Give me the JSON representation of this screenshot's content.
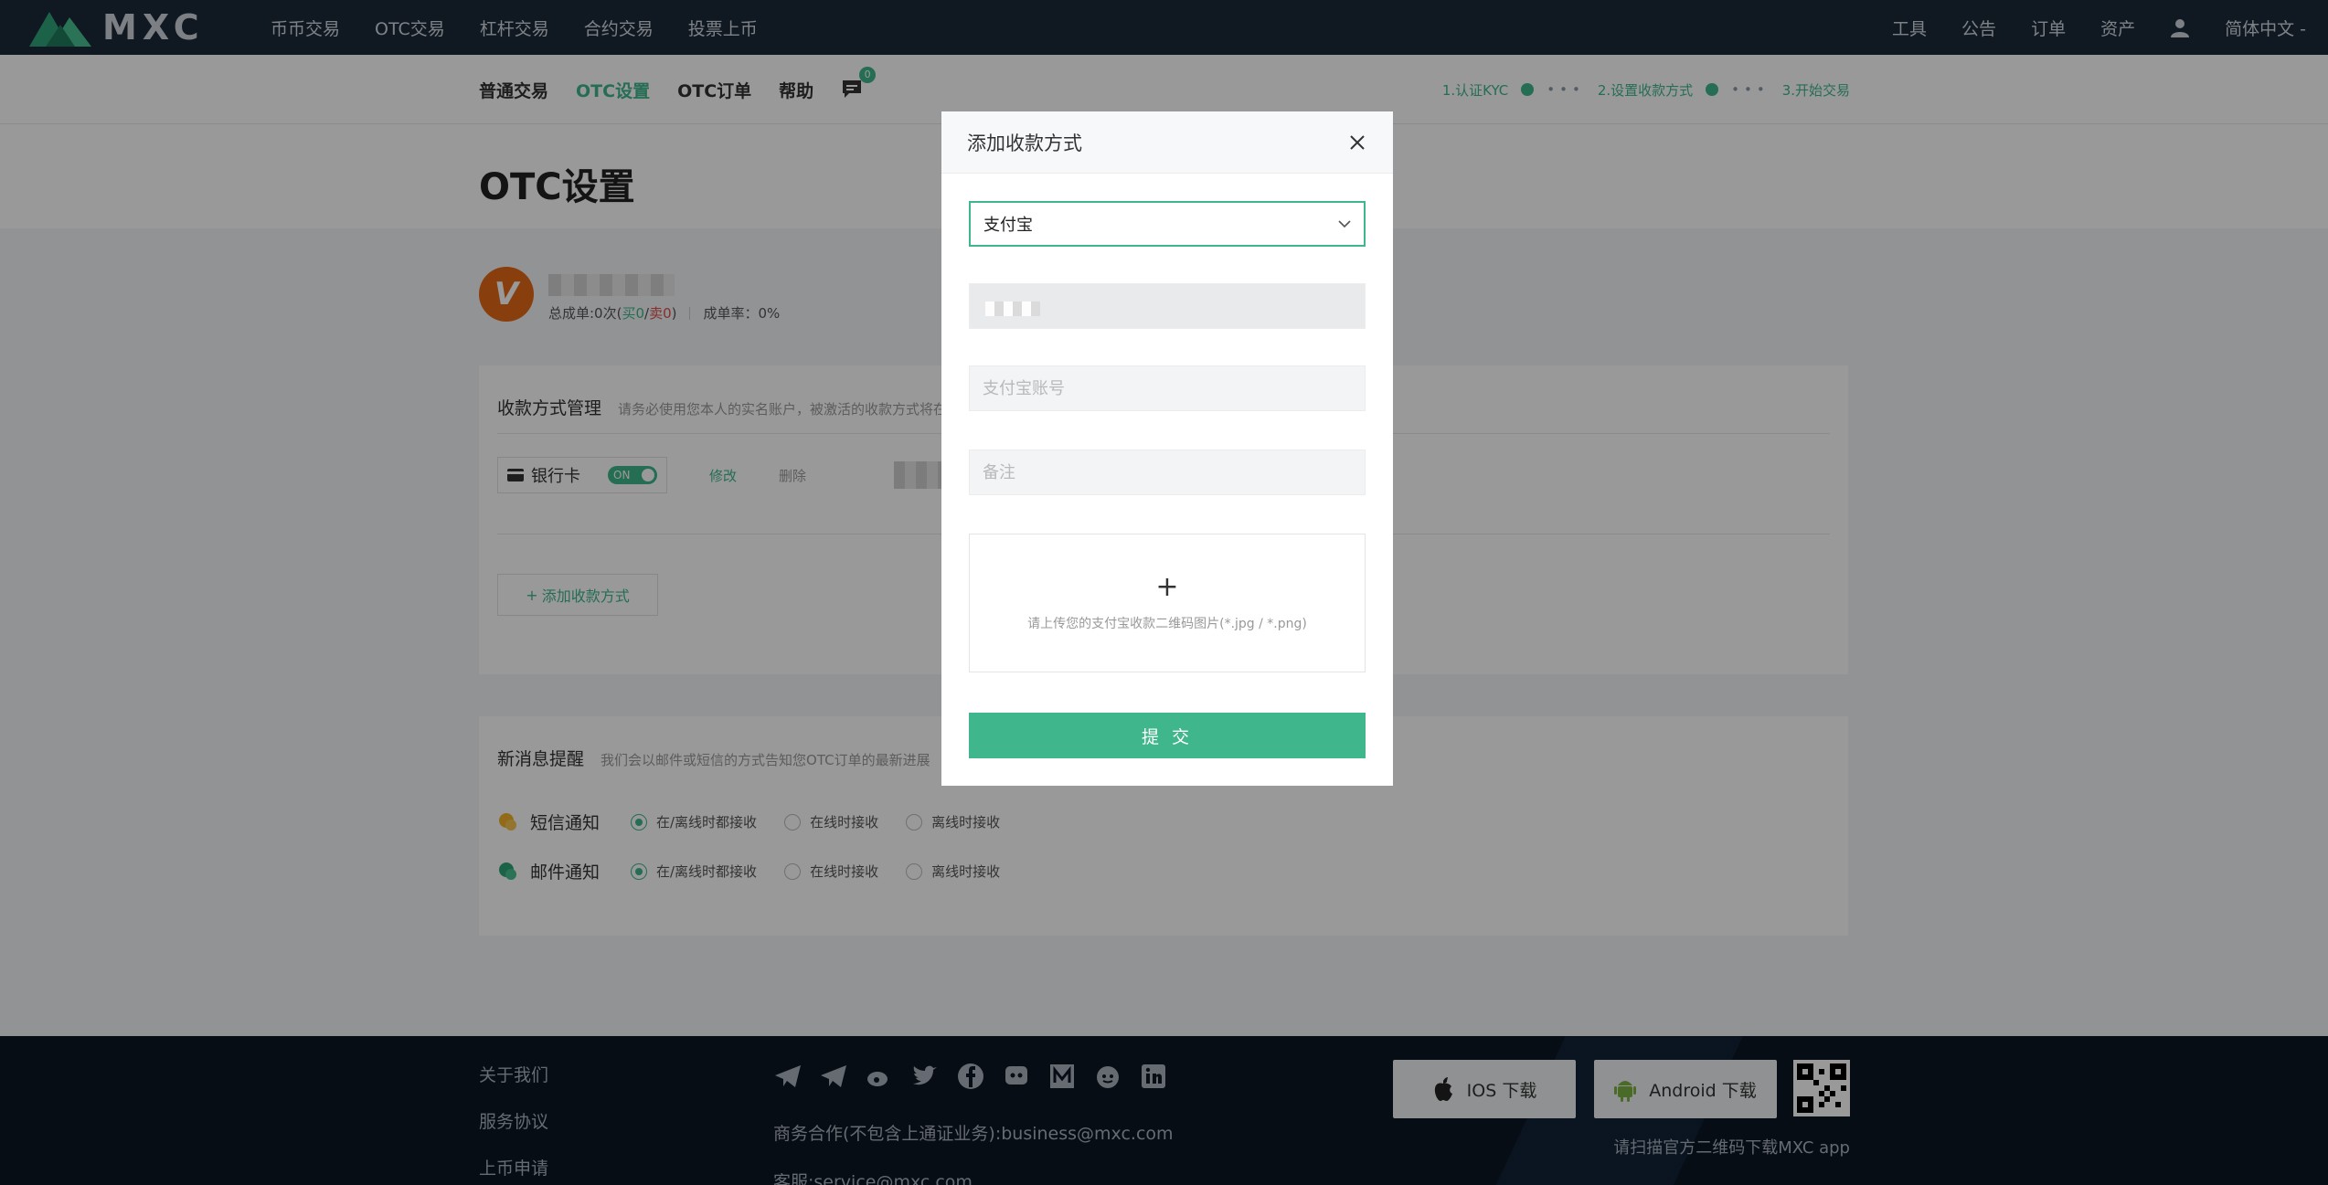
{
  "brand": {
    "name": "MXC",
    "accent": "#3fb68b",
    "nav_bg": "#1b2a3a"
  },
  "topnav": {
    "left_items": [
      "币币交易",
      "OTC交易",
      "杠杆交易",
      "合约交易",
      "投票上币"
    ],
    "right_items": [
      "工具",
      "公告",
      "订单",
      "资产"
    ],
    "language": "简体中文 -"
  },
  "subnav": {
    "items": [
      "普通交易",
      "OTC设置",
      "OTC订单",
      "帮助"
    ],
    "active": "OTC设置",
    "chat_badge": "0",
    "steps": [
      "1.认证KYC",
      "2.设置收款方式",
      "3.开始交易"
    ]
  },
  "page": {
    "title": "OTC设置"
  },
  "profile": {
    "avatar_letter": "V",
    "total_orders": "总成单:0次(",
    "buy": "买0",
    "slash": "/",
    "sell": "卖0",
    "close_paren": ")",
    "rate": "成单率：0%"
  },
  "payment": {
    "title": "收款方式管理",
    "desc": "请务必使用您本人的实名账户，被激活的收款方式将在",
    "bank_label": "银行卡",
    "toggle": "ON",
    "edit": "修改",
    "delete": "删除",
    "add_button": "添加收款方式"
  },
  "notify": {
    "title": "新消息提醒",
    "desc": "我们会以邮件或短信的方式告知您OTC订单的最新进展",
    "rows": [
      {
        "label": "短信通知",
        "options": [
          "在/离线时都接收",
          "在线时接收",
          "离线时接收"
        ],
        "selected": 0
      },
      {
        "label": "邮件通知",
        "options": [
          "在/离线时都接收",
          "在线时接收",
          "离线时接收"
        ],
        "selected": 0
      }
    ]
  },
  "footer": {
    "links": [
      "关于我们",
      "服务协议",
      "上币申请"
    ],
    "business": "商务合作(不包含上通证业务):business@mxc.com",
    "service": "客服:service@mxc.com",
    "ios": "IOS 下载",
    "android": "Android 下载",
    "qr_text": "请扫描官方二维码下载MXC app"
  },
  "modal": {
    "title": "添加收款方式",
    "select_value": "支付宝",
    "account_placeholder": "支付宝账号",
    "note_placeholder": "备注",
    "upload_text": "请上传您的支付宝收款二维码图片(*.jpg / *.png)",
    "submit": "提 交"
  }
}
